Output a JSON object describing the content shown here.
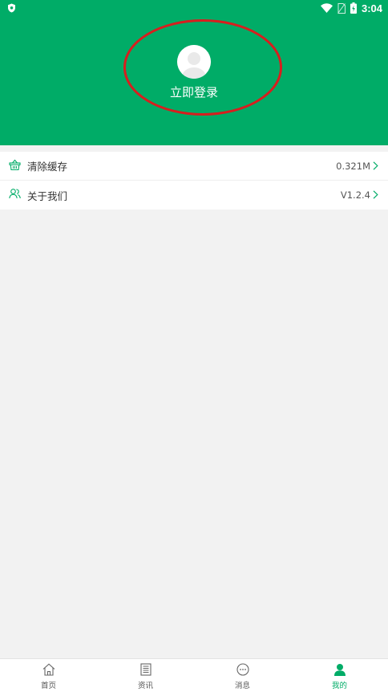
{
  "status_bar": {
    "time": "3:04",
    "icons": [
      "shield-icon",
      "wifi-icon",
      "no-sim-icon",
      "battery-charging-icon"
    ]
  },
  "profile": {
    "login_label": "立即登录",
    "avatar_icon": "user-avatar-icon"
  },
  "settings": {
    "items": [
      {
        "label": "清除缓存",
        "value": "0.321M",
        "icon": "basket-icon"
      },
      {
        "label": "关于我们",
        "value": "V1.2.4",
        "icon": "users-icon"
      }
    ]
  },
  "tabbar": {
    "tabs": [
      {
        "label": "首页",
        "icon": "home-icon"
      },
      {
        "label": "资讯",
        "icon": "news-icon"
      },
      {
        "label": "消息",
        "icon": "chat-icon"
      },
      {
        "label": "我的",
        "icon": "person-icon",
        "active": true
      }
    ]
  },
  "colors": {
    "primary": "#00ac67",
    "highlight_ring": "#d81e1e",
    "background": "#f2f2f2"
  }
}
